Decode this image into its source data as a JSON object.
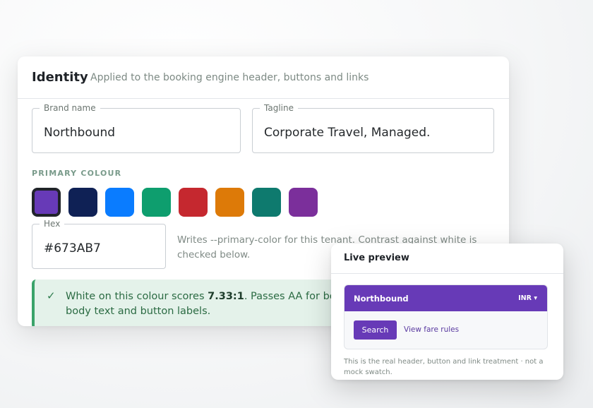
{
  "identity": {
    "title": "Identity",
    "subtitle": "Applied to the booking engine header, buttons and links",
    "brand_name": {
      "label": "Brand name",
      "value": "Northbound"
    },
    "tagline": {
      "label": "Tagline",
      "value": "Corporate Travel, Managed."
    },
    "primary_colour_label": "PRIMARY COLOUR",
    "swatches": [
      {
        "color": "#673AB7",
        "selected": true
      },
      {
        "color": "#0F2155",
        "selected": false
      },
      {
        "color": "#0A7CFF",
        "selected": false
      },
      {
        "color": "#0E9E6E",
        "selected": false
      },
      {
        "color": "#C5282F",
        "selected": false
      },
      {
        "color": "#DD7A08",
        "selected": false
      },
      {
        "color": "#0E7A6E",
        "selected": false
      },
      {
        "color": "#7B2F9B",
        "selected": false
      }
    ],
    "hex": {
      "label": "Hex",
      "value": "#673AB7"
    },
    "hint": "Writes --primary-color for this tenant. Contrast against white is checked below.",
    "contrast": {
      "icon": "check-icon",
      "prefix": "White on this colour scores ",
      "ratio": "7.33:1",
      "suffix": ". Passes AA for both body text and button labels."
    }
  },
  "preview": {
    "title": "Live preview",
    "brand": "Northbound",
    "currency": "INR ▾",
    "button_label": "Search",
    "link_label": "View fare rules",
    "note": "This is the real header, button and link treatment · not a mock swatch."
  },
  "colors": {
    "primary": "#673AB7",
    "success_bg": "#E4F2EA",
    "success_border": "#3AA36A"
  }
}
